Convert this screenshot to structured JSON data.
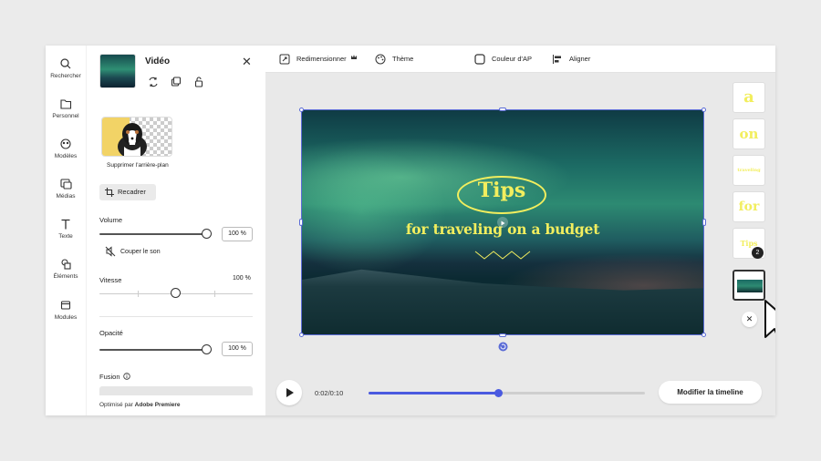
{
  "rail": [
    {
      "label": "Rechercher",
      "icon": "search-icon"
    },
    {
      "label": "Personnel",
      "icon": "folder-icon"
    },
    {
      "label": "Modèles",
      "icon": "templates-icon"
    },
    {
      "label": "Médias",
      "icon": "media-icon"
    },
    {
      "label": "Texte",
      "icon": "text-icon"
    },
    {
      "label": "Éléments",
      "icon": "elements-icon"
    },
    {
      "label": "Modules",
      "icon": "addons-icon"
    }
  ],
  "panel": {
    "title": "Vidéo",
    "remove_bg_label": "Supprimer l'arrière-plan",
    "crop_label": "Recadrer",
    "volume_label": "Volume",
    "volume_value": "100 %",
    "volume_level": 1.0,
    "mute_label": "Couper le son",
    "speed_label": "Vitesse",
    "speed_value": "100 %",
    "speed_level": 0.5,
    "opacity_label": "Opacité",
    "opacity_value": "100 %",
    "opacity_level": 1.0,
    "blend_label": "Fusion",
    "footer_prefix": "Optimisé par",
    "footer_brand": "Adobe Premiere"
  },
  "toolbar": {
    "resize": "Redimensionner",
    "theme": "Thème",
    "bg_color": "Couleur d'AP",
    "align": "Aligner"
  },
  "canvas": {
    "tips": "Tips",
    "subtitle": "for traveling on a budget"
  },
  "thumbs": [
    {
      "text": "a"
    },
    {
      "text": "on"
    },
    {
      "text": "traveling"
    },
    {
      "text": "for"
    },
    {
      "text": "Tips",
      "badge": "2"
    },
    {
      "text": ""
    }
  ],
  "playback": {
    "time": "0:02/0:10",
    "progress": 0.47,
    "timeline_button": "Modifier la timeline"
  },
  "colors": {
    "accent": "#4a5ae0",
    "text_yellow": "#f2ee5e"
  }
}
